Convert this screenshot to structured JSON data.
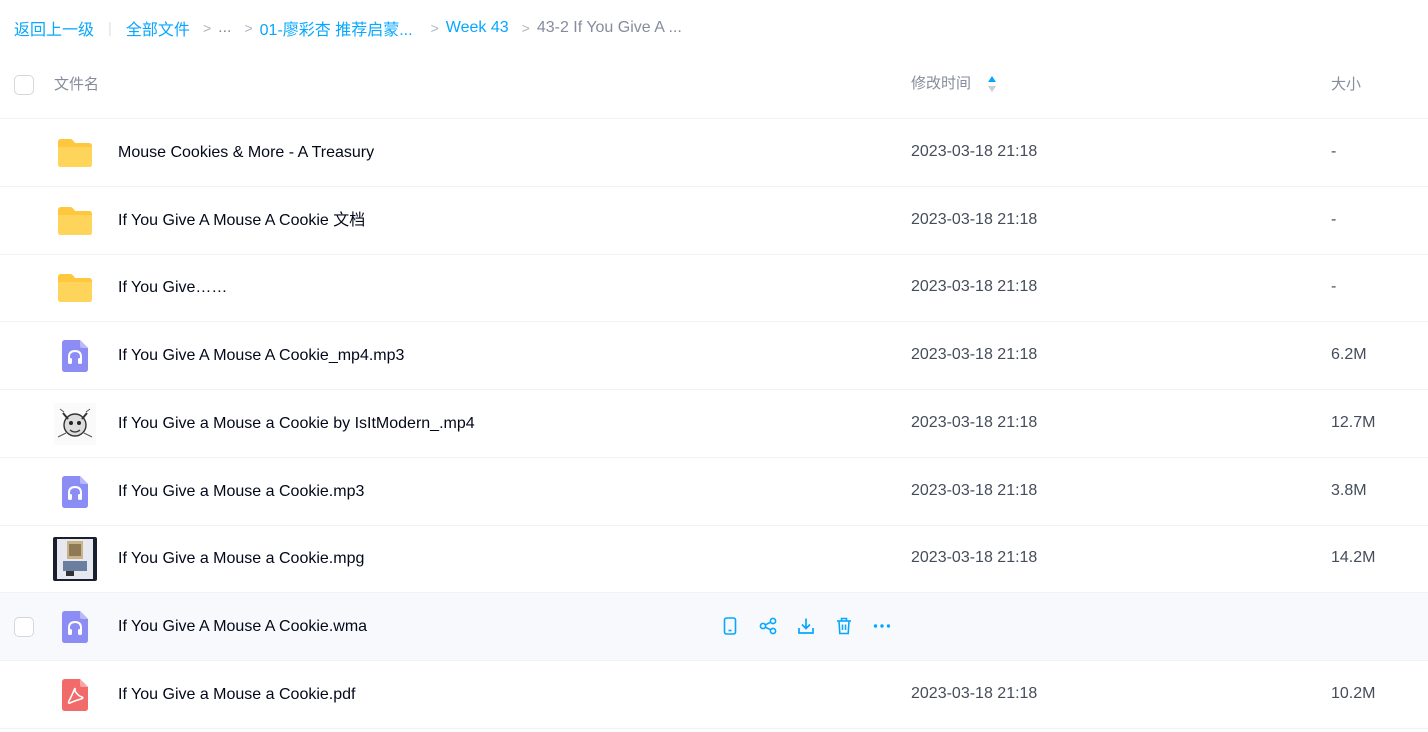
{
  "breadcrumb": {
    "back_label": "返回上一级",
    "all_files_label": "全部文件",
    "ellipsis": "...",
    "folder1": "01-廖彩杏 推荐启蒙...",
    "folder2": "Week 43",
    "current": "43-2 If You Give A ...",
    "separator": ">"
  },
  "table": {
    "columns": {
      "name": "文件名",
      "modified": "修改时间",
      "size": "大小"
    },
    "sort_column": "modified",
    "rows": [
      {
        "type": "folder-icon",
        "name": "Mouse Cookies & More - A Treasury",
        "modified": "2023-03-18 21:18",
        "size": "-"
      },
      {
        "type": "folder-icon",
        "name": "If You Give A Mouse A Cookie 文档",
        "modified": "2023-03-18 21:18",
        "size": "-"
      },
      {
        "type": "folder-icon",
        "name": "If You Give……",
        "modified": "2023-03-18 21:18",
        "size": "-"
      },
      {
        "type": "audio-file-icon",
        "name": "If You Give A Mouse A Cookie_mp4.mp3",
        "modified": "2023-03-18 21:18",
        "size": "6.2M"
      },
      {
        "type": "video-thumbnail",
        "name": "If You Give a Mouse a Cookie by IsItModern_.mp4",
        "modified": "2023-03-18 21:18",
        "size": "12.7M"
      },
      {
        "type": "audio-file-icon",
        "name": "If You Give a Mouse a Cookie.mp3",
        "modified": "2023-03-18 21:18",
        "size": "3.8M"
      },
      {
        "type": "video-thumbnail",
        "name": "If You Give a Mouse a Cookie.mpg",
        "modified": "2023-03-18 21:18",
        "size": "14.2M"
      },
      {
        "type": "audio-file-icon",
        "name": "If You Give A Mouse A Cookie.wma",
        "modified": "",
        "size": "",
        "hovered": true
      },
      {
        "type": "pdf-file-icon",
        "name": "If You Give a Mouse a Cookie.pdf",
        "modified": "2023-03-18 21:18",
        "size": "10.2M"
      }
    ]
  },
  "row_actions": [
    "phone-icon",
    "share-icon",
    "download-icon",
    "trash-icon",
    "more-icon"
  ],
  "colors": {
    "accent": "#06a7ff",
    "folder": "#ffc73d",
    "audio": "#8c8cf5",
    "pdf": "#f26b6b",
    "hover_row": "#f7f9fc"
  }
}
